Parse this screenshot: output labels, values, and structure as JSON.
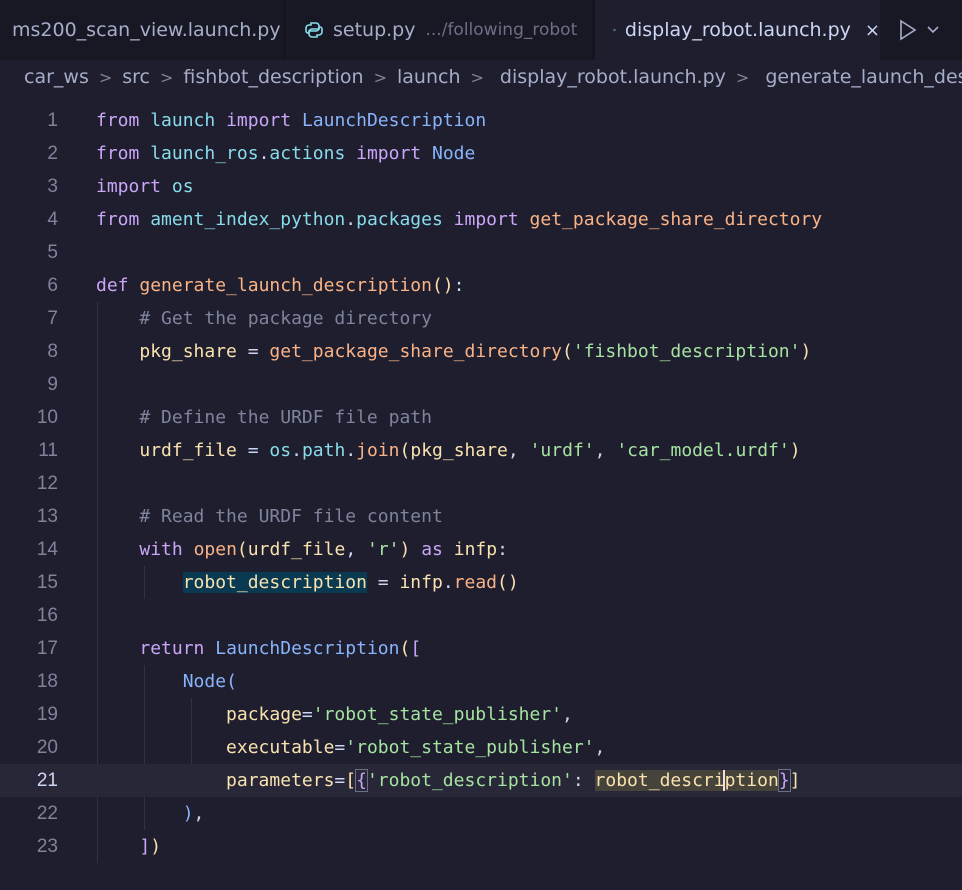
{
  "tabs": [
    {
      "label": "ms200_scan_view.launch.py",
      "active": false
    },
    {
      "label": "setup.py",
      "description": ".../following_robot",
      "active": false
    },
    {
      "label": "display_robot.launch.py",
      "active": true,
      "close": "×"
    }
  ],
  "tab_actions": {
    "run_icon": "run-play-icon",
    "dropdown_icon": "chevron-down-icon"
  },
  "breadcrumb": [
    "car_ws",
    "src",
    "fishbot_description",
    "launch",
    "display_robot.launch.py",
    "generate_launch_description"
  ],
  "editor": {
    "current_line": 21,
    "line_numbers": [
      "1",
      "2",
      "3",
      "4",
      "5",
      "6",
      "7",
      "8",
      "9",
      "10",
      "11",
      "12",
      "13",
      "14",
      "15",
      "16",
      "17",
      "18",
      "19",
      "20",
      "21",
      "22",
      "23"
    ],
    "t": {
      "from": "from",
      "import": "import",
      "def": "def",
      "with": "with",
      "as": "as",
      "return": "return",
      "launch": "launch",
      "LaunchDescription": "LaunchDescription",
      "launch_ros": "launch_ros",
      "actions": "actions",
      "Node": "Node",
      "os": "os",
      "ament_index_python": "ament_index_python",
      "packages": "packages",
      "get_package_share_directory": "get_package_share_directory",
      "generate_launch_description": "generate_launch_description",
      "cmt1": "# Get the package directory",
      "pkg_share": "pkg_share",
      "fishbot_description": "'fishbot_description'",
      "cmt2": "# Define the URDF file path",
      "urdf_file": "urdf_file",
      "path": "path",
      "join": "join",
      "urdf": "'urdf'",
      "car_model": "'car_model.urdf'",
      "cmt3": "# Read the URDF file content",
      "open": "open",
      "r": "'r'",
      "infp": "infp",
      "robot_description": "robot_description",
      "read": "read",
      "package": "package",
      "rsp": "'robot_state_publisher'",
      "executable": "executable",
      "parameters": "parameters",
      "robot_description_str": "'robot_description'",
      "rd_a": "robot_descri",
      "rd_b": "ption"
    }
  }
}
